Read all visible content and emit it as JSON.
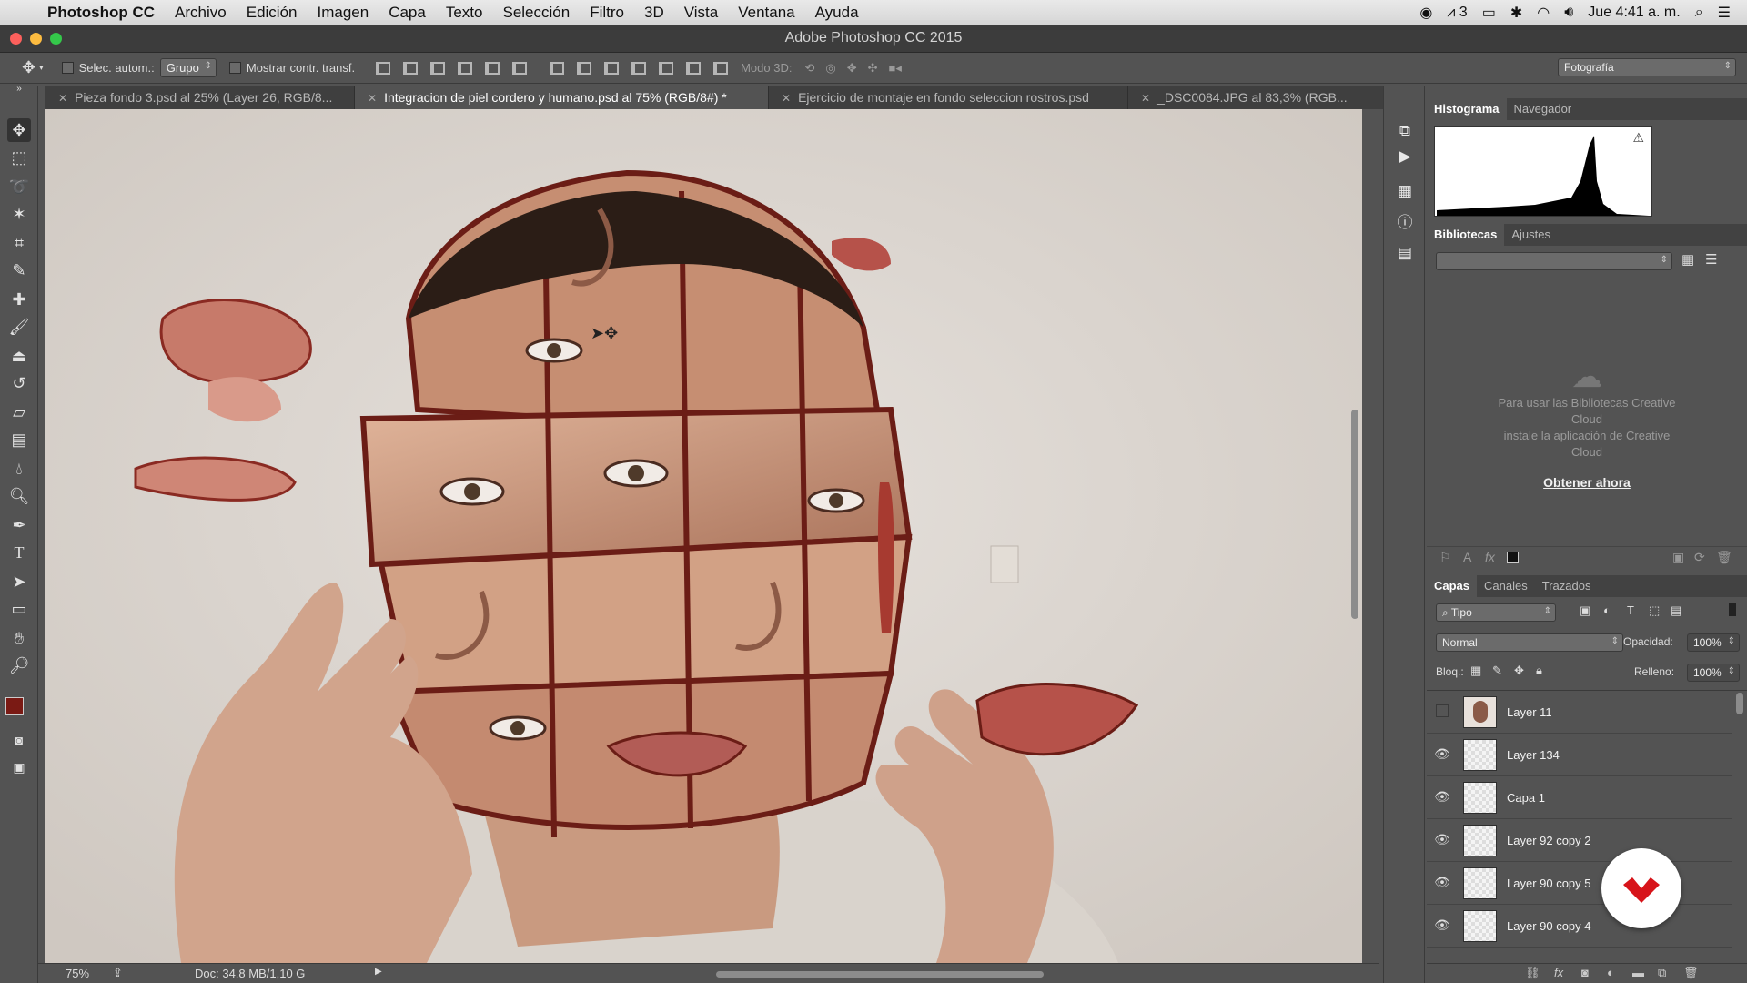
{
  "menubar": {
    "app_name": "Photoshop CC",
    "items": [
      "Archivo",
      "Edición",
      "Imagen",
      "Capa",
      "Texto",
      "Selección",
      "Filtro",
      "3D",
      "Vista",
      "Ventana",
      "Ayuda"
    ],
    "adobe_badge": "3",
    "clock": "Jue 4:41 a. m."
  },
  "window": {
    "title": "Adobe Photoshop CC 2015"
  },
  "options_bar": {
    "auto_select_label": "Selec. autom.:",
    "auto_select_value": "Grupo",
    "show_transform_label": "Mostrar contr. transf.",
    "mode_3d_label": "Modo 3D:",
    "workspace": "Fotografía"
  },
  "tabs": [
    {
      "label": "Pieza fondo 3.psd al 25% (Layer 26, RGB/8...",
      "active": false
    },
    {
      "label": "Integracion de piel cordero y humano.psd al 75% (RGB/8#) *",
      "active": true
    },
    {
      "label": "Ejercicio de montaje en fondo seleccion rostros.psd",
      "active": false
    },
    {
      "label": "_DSC0084.JPG al 83,3% (RGB...",
      "active": false
    }
  ],
  "status_bar": {
    "zoom": "75%",
    "doc_size": "Doc: 34,8 MB/1,10 G"
  },
  "histogram_panel": {
    "tabs": [
      "Histograma",
      "Navegador"
    ],
    "warning_icon": "warning-triangle-icon"
  },
  "libraries_panel": {
    "tabs": [
      "Bibliotecas",
      "Ajustes"
    ],
    "message_line1": "Para usar las Bibliotecas Creative",
    "message_line2": "Cloud",
    "message_line3": "instale la aplicación de Creative",
    "message_line4": "Cloud",
    "link": "Obtener ahora"
  },
  "layers_panel": {
    "tabs": [
      "Capas",
      "Canales",
      "Trazados"
    ],
    "filter_type": "Tipo",
    "blend_mode": "Normal",
    "opacity_label": "Opacidad:",
    "opacity_value": "100%",
    "lock_label": "Bloq.:",
    "fill_label": "Relleno:",
    "fill_value": "100%",
    "layers": [
      {
        "name": "Layer 11",
        "visible": false
      },
      {
        "name": "Layer 134",
        "visible": true
      },
      {
        "name": "Capa 1",
        "visible": true
      },
      {
        "name": "Layer 92 copy 2",
        "visible": true
      },
      {
        "name": "Layer 90 copy 5",
        "visible": true
      },
      {
        "name": "Layer 90 copy 4",
        "visible": true
      }
    ]
  },
  "colors": {
    "foreground": "#7a1a14",
    "background": "#ffffff",
    "watermark_red": "#d7141a"
  }
}
